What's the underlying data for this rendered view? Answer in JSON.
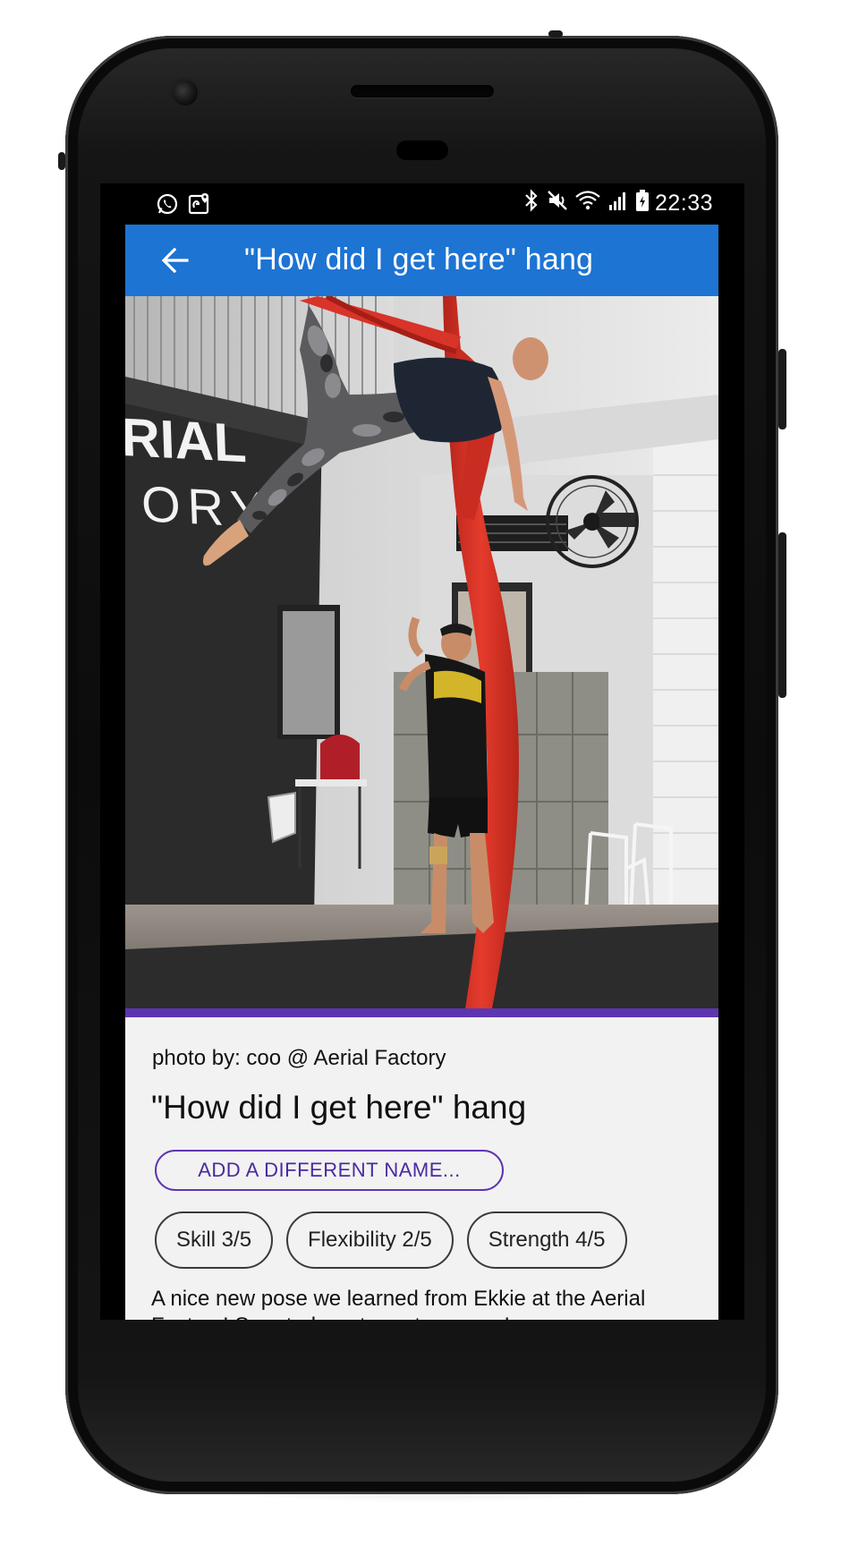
{
  "status_bar": {
    "time": "22:33",
    "left_icons": [
      "whatsapp-icon",
      "maps-location-icon"
    ],
    "right_icons": [
      "bluetooth-icon",
      "mute-icon",
      "wifi-icon",
      "signal-icon",
      "battery-icon"
    ]
  },
  "app_bar": {
    "back_icon": "arrow-left-icon",
    "title": "\"How did I get here\" hang",
    "color": "#1d74d3"
  },
  "photo": {
    "wall_sign_line1": "RIAL",
    "wall_sign_line2": "ORY"
  },
  "accent_color": "#5e35b1",
  "details": {
    "credit": "photo by: coo @ Aerial Factory",
    "title": "\"How did I get here\" hang",
    "add_name_button": "ADD A DIFFERENT NAME...",
    "chips": [
      {
        "label": "Skill 3/5"
      },
      {
        "label": "Flexibility 2/5"
      },
      {
        "label": "Strength 4/5"
      }
    ],
    "description": "A nice new pose we learned from Ekkie at the Aerial Factory! Sore today, strong tomorrow!"
  }
}
